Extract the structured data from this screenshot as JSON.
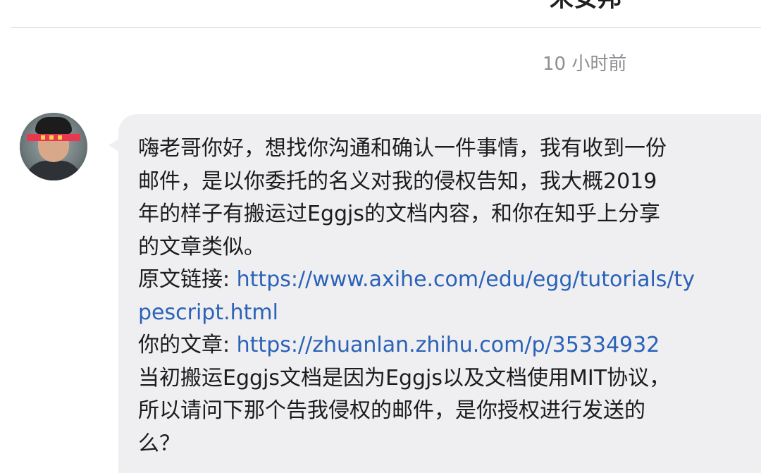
{
  "header": {
    "title": "宋安邦"
  },
  "conversation": {
    "timestamp": "10 小时前",
    "message": {
      "lines": [
        "嗨老哥你好，想找你沟通和确认一件事情，我有收到一份",
        "邮件，是以你委托的名义对我的侵权告知，我大概2019",
        "年的样子有搬运过Eggjs的文档内容，和你在知乎上分享",
        "的文章类似。"
      ],
      "original_label": "原文链接: ",
      "original_link_part1": "https://www.axihe.com/edu/egg/tutorials/ty",
      "original_link_part2": "pescript.html",
      "article_label": "你的文章: ",
      "article_link": "https://zhuanlan.zhihu.com/p/35334932",
      "closing_lines": [
        "当初搬运Eggjs文档是因为Eggjs以及文档使用MIT协议，",
        "所以请问下那个告我侵权的邮件，是你授权进行发送的",
        "么？"
      ]
    }
  }
}
